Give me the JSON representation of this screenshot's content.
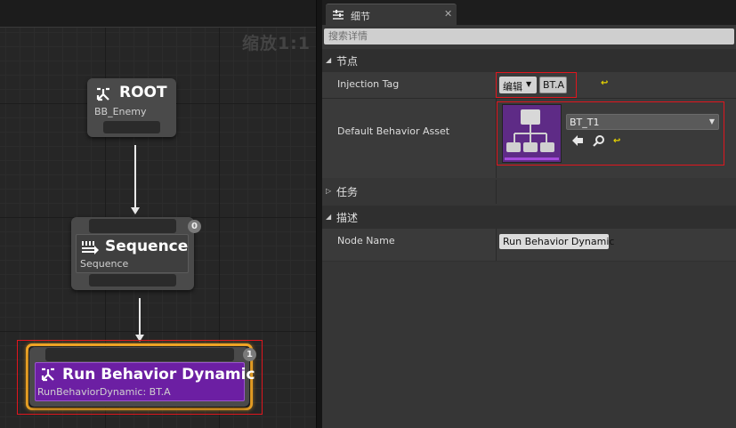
{
  "graph": {
    "zoom_label": "缩放1:1",
    "nodes": {
      "root": {
        "title": "ROOT",
        "subtitle": "BB_Enemy"
      },
      "sequence": {
        "title": "Sequence",
        "subtitle": "Sequence",
        "badge": "0"
      },
      "run_behavior": {
        "title": "Run Behavior Dynamic",
        "subtitle": "RunBehaviorDynamic: BT.A",
        "badge": "1"
      }
    },
    "colors": {
      "run_behavior": "#6c1fa3",
      "selection_outline": "#f0a526",
      "annotation": "#e0161e"
    }
  },
  "details": {
    "tab_label": "细节",
    "tab_icon": "details-icon",
    "search_placeholder": "搜索详情",
    "categories": {
      "node": "节点",
      "task": "任务",
      "description": "描述"
    },
    "properties": {
      "injection_tag": {
        "label": "Injection Tag",
        "edit_button": "编辑",
        "value": "BT.A"
      },
      "default_behavior_asset": {
        "label": "Default Behavior Asset",
        "asset_name": "BT_T1"
      },
      "node_name": {
        "label": "Node Name",
        "value": "Run Behavior Dynamic"
      }
    }
  }
}
